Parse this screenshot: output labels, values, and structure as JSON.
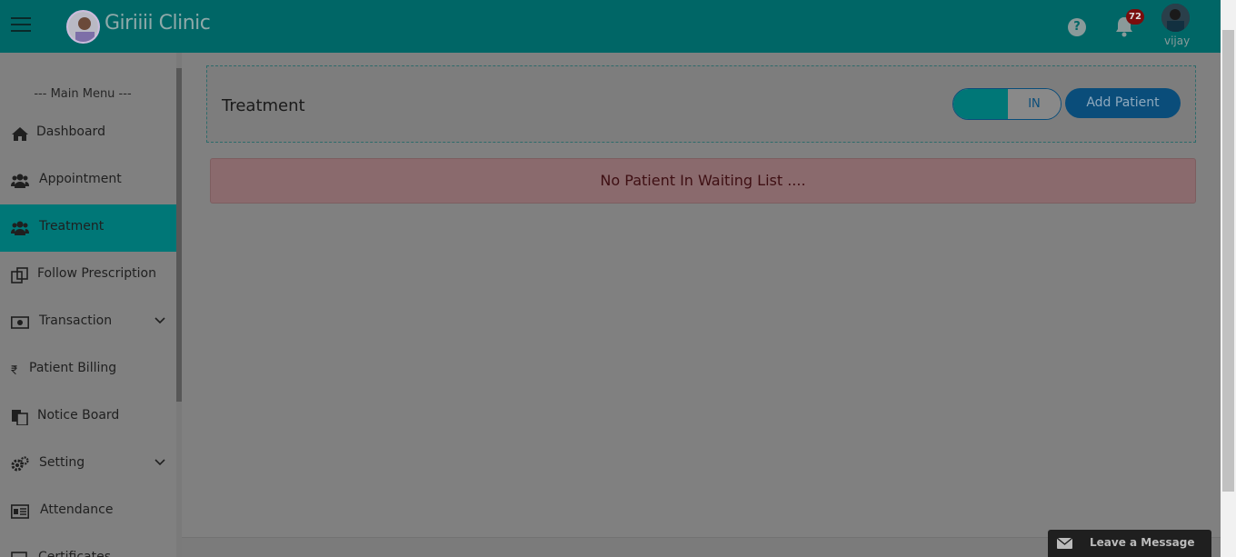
{
  "header": {
    "clinic_name": "Giriiii Clinic",
    "notification_count": "72",
    "user_name": "vijay",
    "help_glyph": "?"
  },
  "sidebar": {
    "menu_heading": "--- Main Menu ---",
    "items": [
      {
        "label": "Dashboard",
        "icon": "home-icon"
      },
      {
        "label": "Appointment",
        "icon": "users-icon"
      },
      {
        "label": "Treatment",
        "icon": "users-icon",
        "active": true
      },
      {
        "label": "Follow Prescription",
        "icon": "copy-icon"
      },
      {
        "label": "Transaction",
        "icon": "money-icon",
        "expandable": true
      },
      {
        "label": "Patient Billing",
        "icon": "rupee-icon"
      },
      {
        "label": "Notice Board",
        "icon": "files-icon"
      },
      {
        "label": "Setting",
        "icon": "gears-icon",
        "expandable": true
      },
      {
        "label": "Attendance",
        "icon": "id-card-icon"
      },
      {
        "label": "Certificates",
        "icon": "certificate-icon"
      }
    ]
  },
  "main": {
    "title": "Treatment",
    "toggle_label": "IN",
    "add_patient_label": "Add Patient",
    "empty_message": "No Patient In Waiting List ...."
  },
  "chat_widget": {
    "label": "Leave a Message"
  },
  "colors": {
    "header_bg": "#006666",
    "active_item_bg": "#007777",
    "primary_button": "#0a4d7a",
    "overlay": "#808080"
  }
}
